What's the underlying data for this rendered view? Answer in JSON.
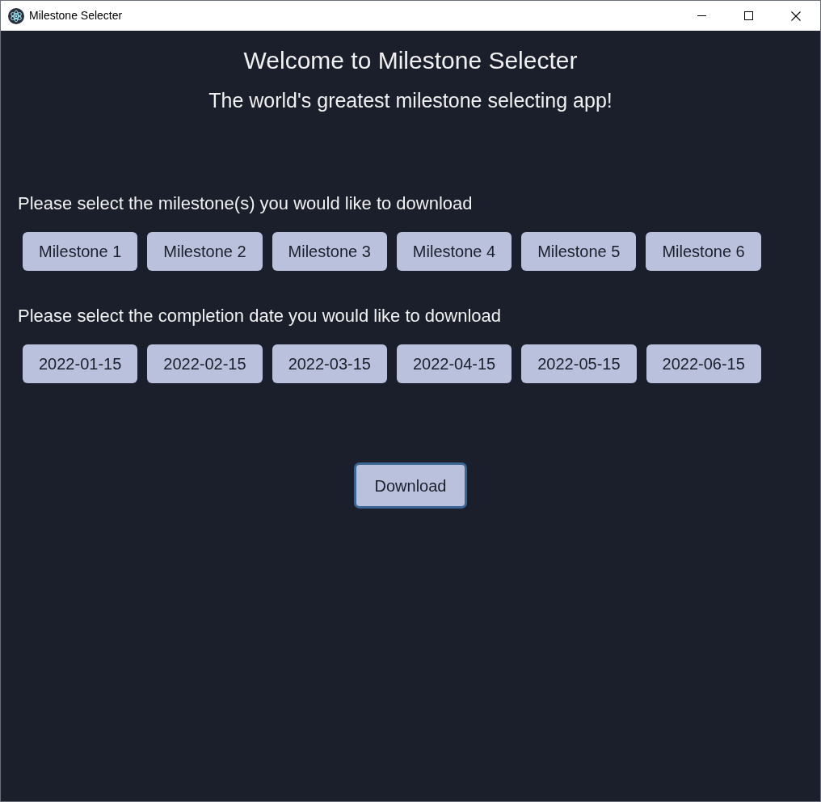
{
  "window": {
    "title": "Milestone Selecter"
  },
  "header": {
    "title": "Welcome to Milestone Selecter",
    "subtitle": "The world's greatest milestone selecting app!"
  },
  "milestones": {
    "label": "Please select the milestone(s) you would like to download",
    "options": [
      "Milestone 1",
      "Milestone 2",
      "Milestone 3",
      "Milestone 4",
      "Milestone 5",
      "Milestone 6"
    ]
  },
  "dates": {
    "label": "Please select the completion date you would like to download",
    "options": [
      "2022-01-15",
      "2022-02-15",
      "2022-03-15",
      "2022-04-15",
      "2022-05-15",
      "2022-06-15"
    ]
  },
  "download_button": {
    "label": "Download",
    "focused": true
  }
}
